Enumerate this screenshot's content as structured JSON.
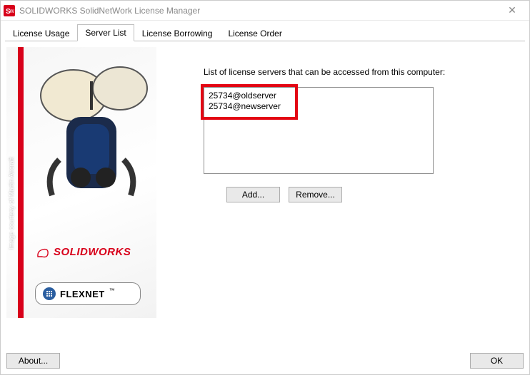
{
  "window": {
    "title": "SOLIDWORKS SolidNetWork License Manager"
  },
  "tabs": [
    {
      "label": "License Usage"
    },
    {
      "label": "Server List"
    },
    {
      "label": "License Borrowing"
    },
    {
      "label": "License Order"
    }
  ],
  "active_tab_index": 1,
  "panel": {
    "caption": "List of license servers that can be accessed from this computer:",
    "servers": [
      "25734@oldserver",
      "25734@newserver"
    ],
    "add_label": "Add...",
    "remove_label": "Remove..."
  },
  "sidebar": {
    "credit": "Image courtesy of Martin Aircraft",
    "brand": "SOLIDWORKS",
    "flexnet": "FLEXNET",
    "flexnet_tm": "™"
  },
  "footer": {
    "about_label": "About...",
    "ok_label": "OK"
  },
  "colors": {
    "accent_red": "#d8001a",
    "highlight_red": "#e30613"
  }
}
